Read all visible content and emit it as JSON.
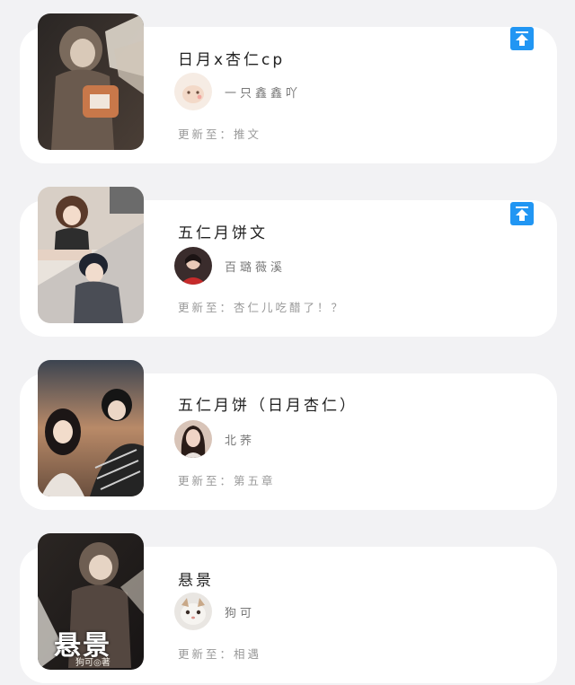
{
  "accent_color": "#2196f3",
  "update_prefix": "更新至：",
  "books": [
    {
      "title": "日月x杏仁cp",
      "author": "一只鑫鑫吖",
      "update": "推文",
      "pinned": true,
      "cover_icon": "hooded-figure-with-wings-cover",
      "avatar_icon": "cat-avatar"
    },
    {
      "title": "五仁月饼文",
      "author": "百璐薇溪",
      "update": "杏仁儿吃醋了！？",
      "pinned": true,
      "cover_icon": "anime-couple-split-cover",
      "avatar_icon": "girl-in-red-avatar"
    },
    {
      "title": "五仁月饼（日月杏仁）",
      "author": "北荞",
      "update": "第五章",
      "pinned": false,
      "cover_icon": "anime-couple-sunset-cover",
      "avatar_icon": "girl-portrait-avatar"
    },
    {
      "title": "悬景",
      "author": "狗可",
      "update": "相遇",
      "pinned": false,
      "cover_icon": "hooded-figure-title-cover",
      "avatar_icon": "cat-face-avatar",
      "cover_text": "悬景",
      "cover_credit": "狗可◎著"
    }
  ]
}
